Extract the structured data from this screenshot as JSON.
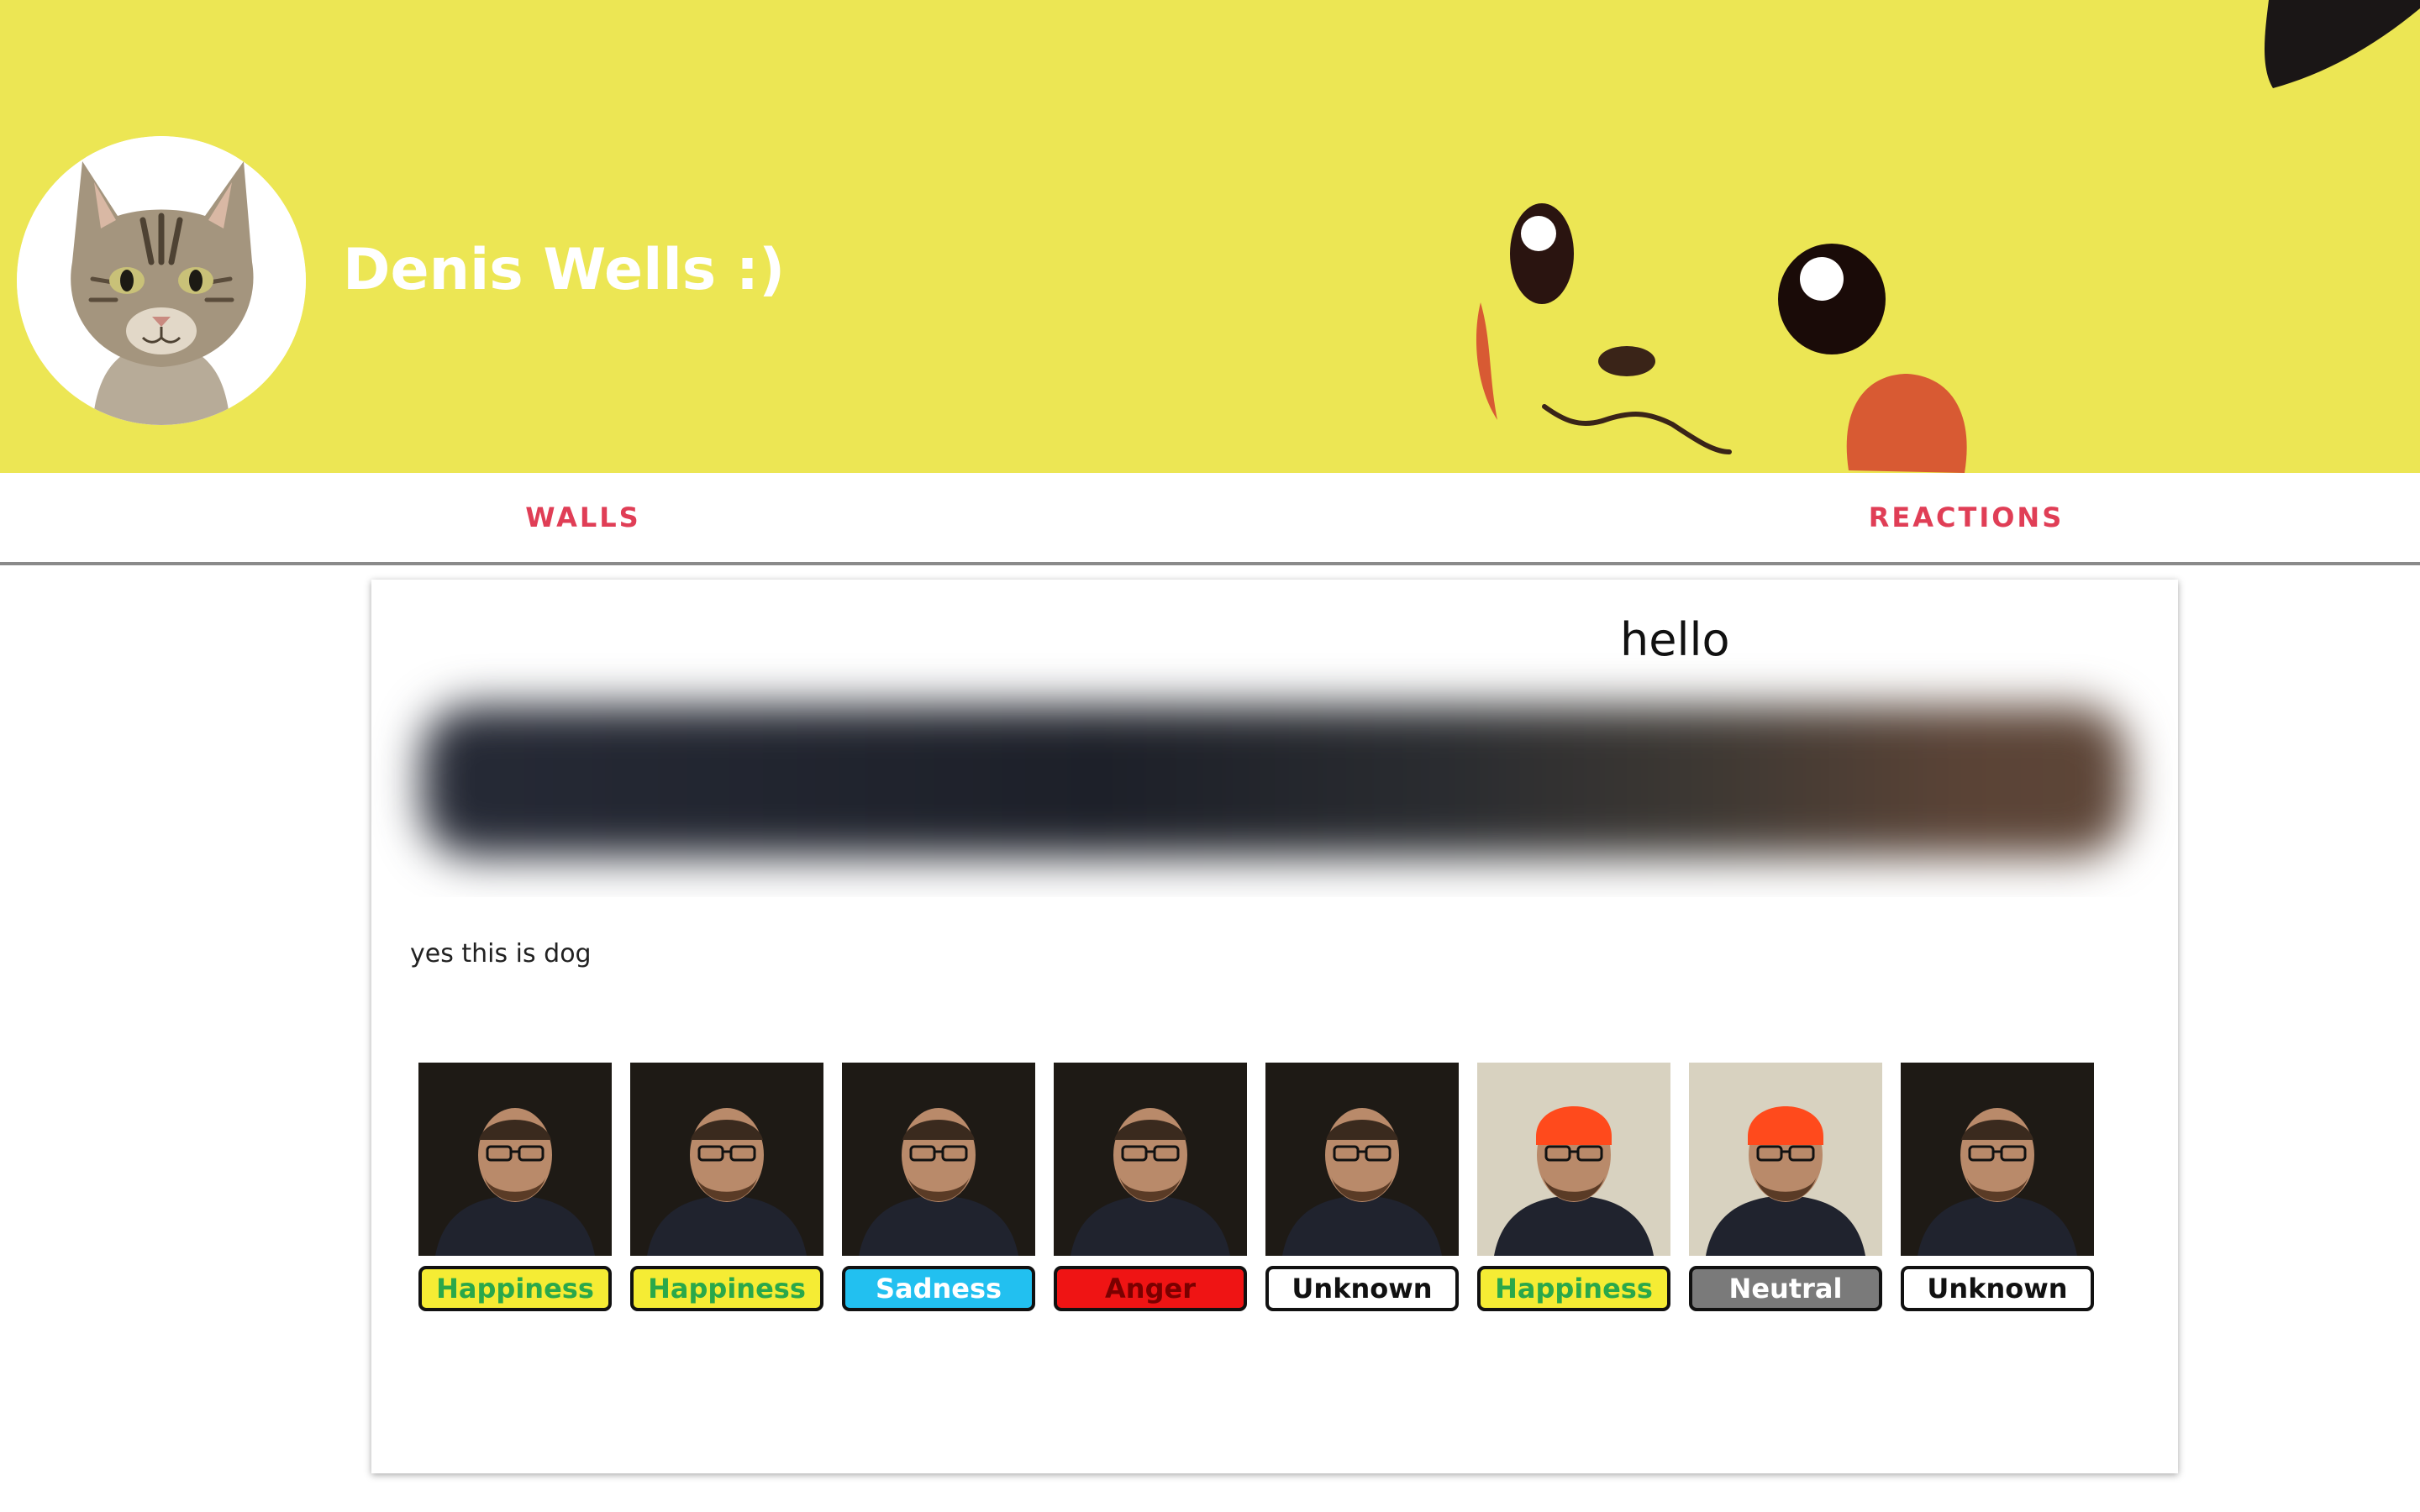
{
  "profile": {
    "name": "Denis Wells :)",
    "avatar_icon": "cat-avatar"
  },
  "banner": {
    "background_color": "#ece654",
    "art": "pikachu-face"
  },
  "nav": {
    "tabs": [
      {
        "label": "WALLS"
      },
      {
        "label": "REACTIONS"
      }
    ],
    "accent_color": "#e03e56"
  },
  "post": {
    "title": "hello",
    "body": "yes this is dog",
    "reactions": [
      {
        "emotion": "Happiness",
        "bg": "#f5ec34",
        "fg": "#2aa84a",
        "hat": false
      },
      {
        "emotion": "Happiness",
        "bg": "#f5ec34",
        "fg": "#2aa84a",
        "hat": false
      },
      {
        "emotion": "Sadness",
        "bg": "#22c0f0",
        "fg": "#ffffff",
        "hat": false
      },
      {
        "emotion": "Anger",
        "bg": "#ef1414",
        "fg": "#7a0000",
        "hat": false
      },
      {
        "emotion": "Unknown",
        "bg": "#ffffff",
        "fg": "#111111",
        "hat": false
      },
      {
        "emotion": "Happiness",
        "bg": "#f5ec34",
        "fg": "#2aa84a",
        "hat": true
      },
      {
        "emotion": "Neutral",
        "bg": "#7a7a7a",
        "fg": "#ffffff",
        "hat": true
      },
      {
        "emotion": "Unknown",
        "bg": "#ffffff",
        "fg": "#111111",
        "hat": false
      }
    ]
  }
}
